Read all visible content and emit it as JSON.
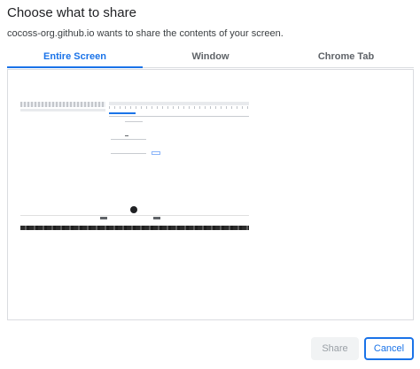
{
  "dialog": {
    "title": "Choose what to share",
    "subtitle": "cocoss-org.github.io wants to share the contents of your screen."
  },
  "tabs": [
    {
      "label": "Entire Screen",
      "active": true
    },
    {
      "label": "Window",
      "active": false
    },
    {
      "label": "Chrome Tab",
      "active": false
    }
  ],
  "buttons": {
    "share_label": "Share",
    "cancel_label": "Cancel"
  },
  "colors": {
    "accent": "#1a73e8",
    "inactive_tab": "#5f6368",
    "disabled_button_bg": "#f1f3f4"
  }
}
